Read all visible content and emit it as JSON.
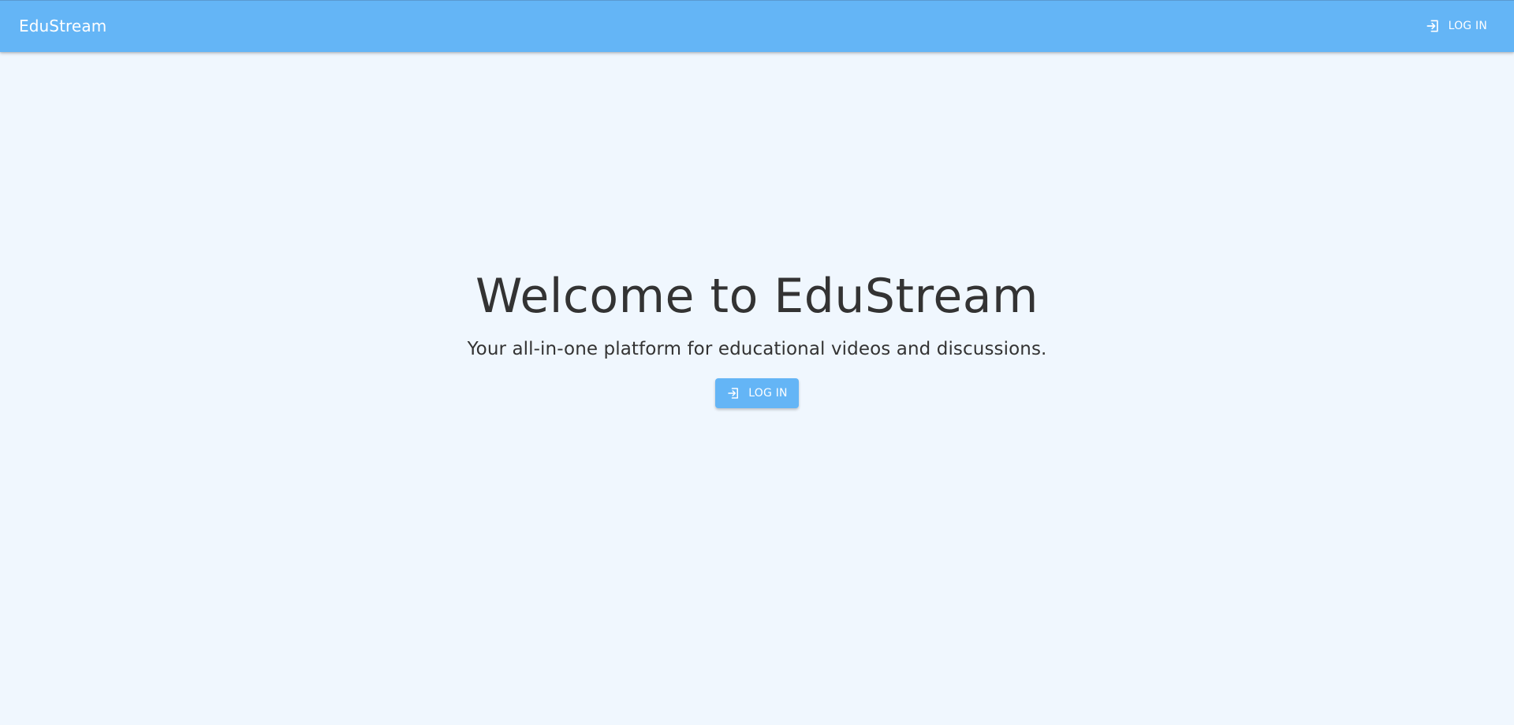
{
  "app": {
    "brand": "EduStream"
  },
  "header": {
    "login_label": "LOG IN",
    "login_icon": "login-icon"
  },
  "hero": {
    "title": "Welcome to EduStream",
    "subtitle": "Your all-in-one platform for educational videos and discussions.",
    "login_label": "LOG IN",
    "login_icon": "login-icon"
  },
  "colors": {
    "primary": "#64b5f6",
    "background": "#f0f7fe",
    "text": "#333333",
    "on_primary": "#ffffff"
  }
}
